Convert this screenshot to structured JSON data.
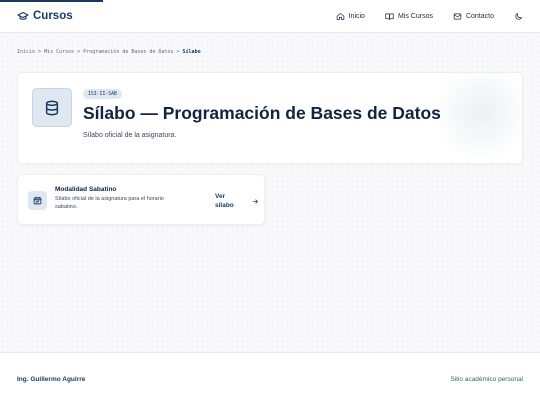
{
  "header": {
    "brand": "Cursos",
    "nav": {
      "home": "Inicio",
      "my_courses": "Mis Cursos",
      "contact": "Contacto"
    }
  },
  "breadcrumb": {
    "items": [
      "Inicio",
      "Mis Cursos",
      "Programación de Bases de Datos"
    ],
    "current": "Sílabo",
    "separator": ">"
  },
  "hero": {
    "code": "ISI-II-SAB",
    "title": "Sílabo — Programación de Bases de Datos",
    "subtitle": "Sílabo oficial de la asignatura."
  },
  "syllabus_card": {
    "title": "Modalidad Sabatino",
    "description": "Sílabo oficial de la asignatura para el horario sabatino.",
    "link_label": "Ver sílabo"
  },
  "footer": {
    "author": "Ing. Guillermo Aguirre",
    "tagline": "Sitio académico personal"
  },
  "colors": {
    "primary": "#173a5e",
    "accent_green": "#2f6b5a",
    "badge_bg": "#dfe7f0"
  }
}
